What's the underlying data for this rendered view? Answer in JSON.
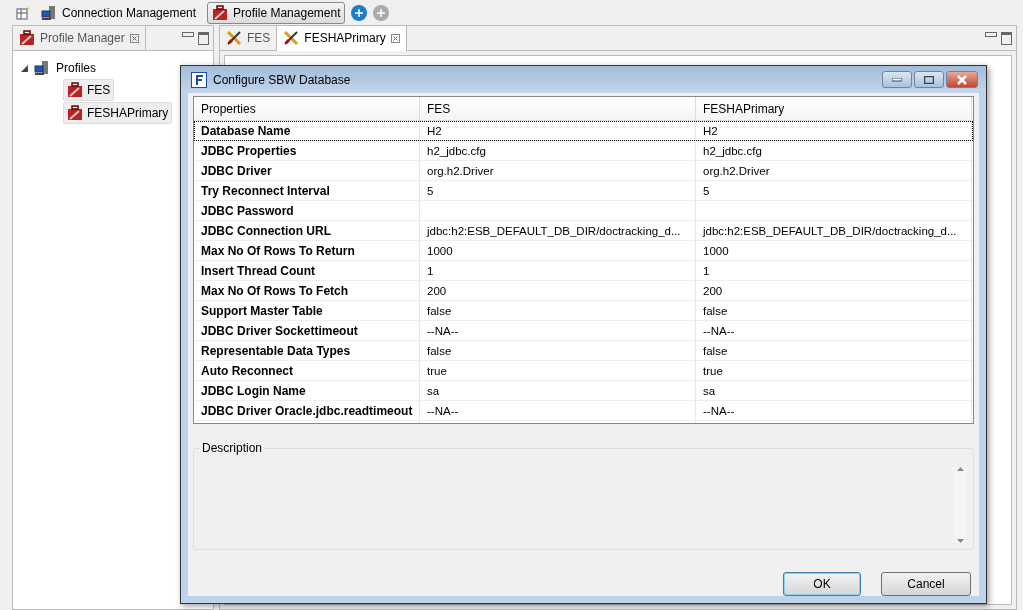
{
  "toolbar": {
    "items": [
      {
        "label": "Connection Management",
        "selected": false
      },
      {
        "label": "Profile Management",
        "selected": true
      }
    ]
  },
  "profile_manager": {
    "title": "Profile Manager",
    "tree": [
      {
        "label": "Profiles",
        "expanded": true,
        "selected": false,
        "children": [
          {
            "label": "FES",
            "selected": true
          },
          {
            "label": "FESHAPrimary",
            "selected": true
          }
        ]
      }
    ]
  },
  "editor_tabs": [
    {
      "label": "FES",
      "selected": false
    },
    {
      "label": "FESHAPrimary",
      "selected": true
    }
  ],
  "dialog": {
    "title": "Configure SBW Database",
    "columns": [
      "Properties",
      "FES",
      "FESHAPrimary"
    ],
    "rows": [
      {
        "property": "Database Name",
        "values": [
          "H2",
          "H2"
        ],
        "selected": true
      },
      {
        "property": "JDBC Properties",
        "values": [
          "h2_jdbc.cfg",
          "h2_jdbc.cfg"
        ],
        "selected": false
      },
      {
        "property": "JDBC Driver",
        "values": [
          "org.h2.Driver",
          "org.h2.Driver"
        ],
        "selected": false
      },
      {
        "property": "Try Reconnect Interval",
        "values": [
          "5",
          "5"
        ],
        "selected": false
      },
      {
        "property": "JDBC Password",
        "values": [],
        "selected": false
      },
      {
        "property": "JDBC Connection URL",
        "values": [
          "jdbc:h2:ESB_DEFAULT_DB_DIR/doctracking_d...",
          "jdbc:h2:ESB_DEFAULT_DB_DIR/doctracking_d..."
        ],
        "selected": false
      },
      {
        "property": "Max No Of Rows To Return",
        "values": [
          "1000",
          "1000"
        ],
        "selected": false
      },
      {
        "property": "Insert Thread Count",
        "values": [
          "1",
          "1"
        ],
        "selected": false
      },
      {
        "property": "Max No Of Rows To Fetch",
        "values": [
          "200",
          "200"
        ],
        "selected": false
      },
      {
        "property": "Support Master Table",
        "values": [
          "false",
          "false"
        ],
        "selected": false
      },
      {
        "property": "JDBC Driver Sockettimeout",
        "values": [
          "--NA--",
          "--NA--"
        ],
        "selected": false
      },
      {
        "property": "Representable Data Types",
        "values": [
          "false",
          "false"
        ],
        "selected": false
      },
      {
        "property": "Auto Reconnect",
        "values": [
          "true",
          "true"
        ],
        "selected": false
      },
      {
        "property": "JDBC Login Name",
        "values": [
          "sa",
          "sa"
        ],
        "selected": false
      },
      {
        "property": "JDBC Driver Oracle.jdbc.readtimeout",
        "values": [
          "--NA--",
          "--NA--"
        ],
        "selected": false
      }
    ],
    "description": {
      "label": "Description"
    },
    "buttons": [
      {
        "label": "OK",
        "default": true
      },
      {
        "label": "Cancel",
        "default": false
      }
    ]
  }
}
